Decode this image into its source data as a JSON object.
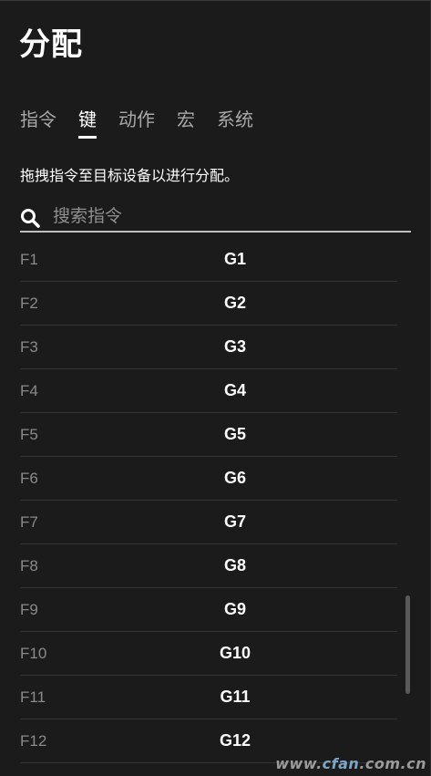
{
  "header": {
    "title": "分配"
  },
  "tabs": [
    {
      "label": "指令",
      "active": false
    },
    {
      "label": "键",
      "active": true
    },
    {
      "label": "动作",
      "active": false
    },
    {
      "label": "宏",
      "active": false
    },
    {
      "label": "系统",
      "active": false
    }
  ],
  "hint": "拖拽指令至目标设备以进行分配。",
  "search": {
    "placeholder": "搜索指令",
    "value": ""
  },
  "keys": [
    {
      "key": "F1",
      "g": "G1"
    },
    {
      "key": "F2",
      "g": "G2"
    },
    {
      "key": "F3",
      "g": "G3"
    },
    {
      "key": "F4",
      "g": "G4"
    },
    {
      "key": "F5",
      "g": "G5"
    },
    {
      "key": "F6",
      "g": "G6"
    },
    {
      "key": "F7",
      "g": "G7"
    },
    {
      "key": "F8",
      "g": "G8"
    },
    {
      "key": "F9",
      "g": "G9"
    },
    {
      "key": "F10",
      "g": "G10"
    },
    {
      "key": "F11",
      "g": "G11"
    },
    {
      "key": "F12",
      "g": "G12"
    }
  ],
  "watermark": {
    "prefix": "www.",
    "accent": "cfan",
    "suffix": ".com.cn"
  },
  "colors": {
    "background": "#1b1b1b",
    "text": "#ffffff",
    "muted": "#8a8a8a",
    "divider": "#333333"
  }
}
